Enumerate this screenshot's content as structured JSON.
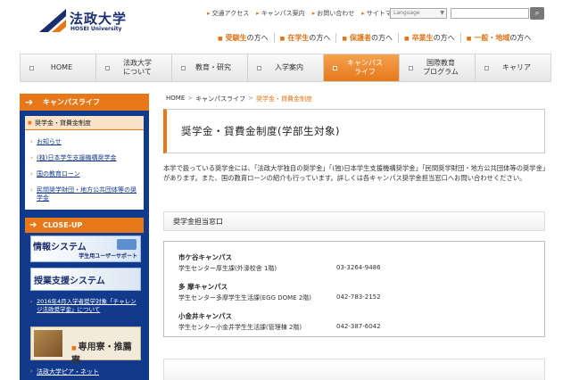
{
  "header": {
    "logo_ja": "法政大学",
    "logo_en": "HOSEI University",
    "util_links": [
      "交通アクセス",
      "キャンパス案内",
      "お問い合わせ",
      "サイトマップ"
    ],
    "language_label": "Language",
    "audience": [
      {
        "em": "受験生",
        "rest": "の方へ"
      },
      {
        "em": "在学生",
        "rest": "の方へ"
      },
      {
        "em": "保護者",
        "rest": "の方へ"
      },
      {
        "em": "卒業生",
        "rest": "の方へ"
      },
      {
        "em": "一般・地域",
        "rest": "の方へ"
      }
    ]
  },
  "nav": {
    "items": [
      {
        "line1": "HOME",
        "line2": ""
      },
      {
        "line1": "法政大学",
        "line2": "について"
      },
      {
        "line1": "教育・研究",
        "line2": ""
      },
      {
        "line1": "入学案内",
        "line2": ""
      },
      {
        "line1": "キャンパス",
        "line2": "ライフ"
      },
      {
        "line1": "国際教育",
        "line2": "プログラム"
      },
      {
        "line1": "キャリア",
        "line2": ""
      }
    ]
  },
  "sidebar": {
    "title": "キャンパスライフ",
    "selected": "奨学金・貸費金制度",
    "links": [
      "お知らせ",
      "(独)日本学生支援機構奨学金",
      "国の教育ローン",
      "民間奨学財団・地方公共団体等の奨学金"
    ],
    "closeup": "CLOSE-UP",
    "banner1_title": "情報システム",
    "banner1_sub": "学生用ユーザーサポート",
    "banner2_title": "授業支援システム",
    "news": "2016年4月入学者奨学対象「チャレンジ法政奨学金」について",
    "banner3_title": "専用寮・推薦寮",
    "news2": "法政大学ピア・ネット"
  },
  "breadcrumb": {
    "home": "HOME",
    "sep": ">",
    "parent": "キャンパスライフ",
    "current": "奨学金・貸費金制度"
  },
  "main": {
    "title": "奨学金・貸費金制度(学部生対象)",
    "intro": "本学で扱っている奨学金には、「法政大学独自の奨学金」「(独)日本学生支援機構奨学金」「民間奨学財団・地方公共団体等の奨学金」があります。また、国の教育ローンの紹介も行っています。詳しくは各キャンパス奨学金担当窓口へお問い合わせください。",
    "section_title": "奨学金担当窓口",
    "contacts": [
      {
        "campus": "市ケ谷キャンパス",
        "office": "学生センター厚生課(外濠校舎 1階)",
        "tel": "03-3264-9486"
      },
      {
        "campus": "多 摩キャンパス",
        "office": "学生センター多摩学生生活課(EGG DOME 2階)",
        "tel": "042-783-2152"
      },
      {
        "campus": "小金井キャンパス",
        "office": "学生センター小金井学生生活課(管理棟 2階)",
        "tel": "042-387-6042"
      }
    ]
  }
}
